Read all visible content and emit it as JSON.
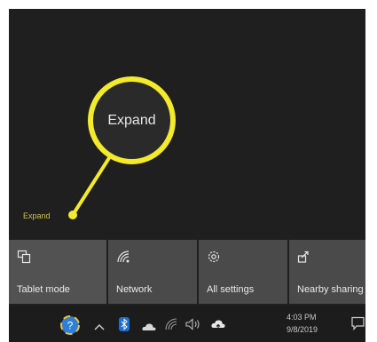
{
  "callout": {
    "zoom_label": "Expand",
    "link_label": "Expand",
    "highlight_color": "#f2ea2a"
  },
  "quick_actions": [
    {
      "label": "Tablet mode",
      "icon": "tablet-mode-icon"
    },
    {
      "label": "Network",
      "icon": "network-icon"
    },
    {
      "label": "All settings",
      "icon": "settings-gear-icon"
    },
    {
      "label": "Nearby sharing",
      "icon": "nearby-sharing-icon"
    }
  ],
  "taskbar": {
    "tray_icons": [
      "help-icon",
      "chevron-up-icon",
      "bluetooth-icon",
      "onedrive-icon",
      "wifi-icon",
      "volume-icon",
      "cloud-icon"
    ],
    "time": "4:03 PM",
    "date": "9/8/2019",
    "notification_icon": "action-center-icon"
  }
}
